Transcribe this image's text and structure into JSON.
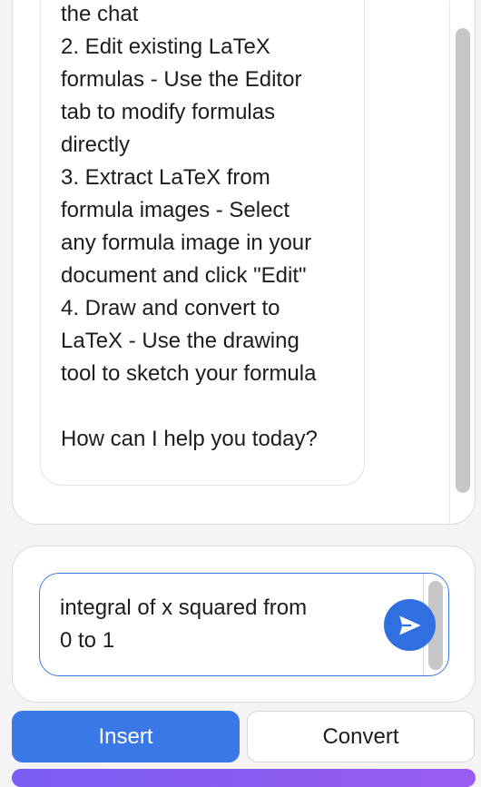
{
  "chat": {
    "message": "the chat\n2. Edit existing LaTeX\nformulas - Use the Editor\ntab to modify formulas\ndirectly\n3. Extract LaTeX from\nformula images - Select\nany formula image in your\ndocument and click \"Edit\"\n4. Draw and convert to\nLaTeX - Use the drawing\ntool to sketch your formula\n\nHow can I help you today?"
  },
  "input": {
    "value": "integral of x squared from\n0 to 1"
  },
  "icons": {
    "send": "send-icon"
  },
  "buttons": {
    "insert_label": "Insert",
    "convert_label": "Convert"
  },
  "colors": {
    "accent": "#3b78e7",
    "send": "#2f6fe0",
    "bottom_bar": "#8a5cf0"
  }
}
